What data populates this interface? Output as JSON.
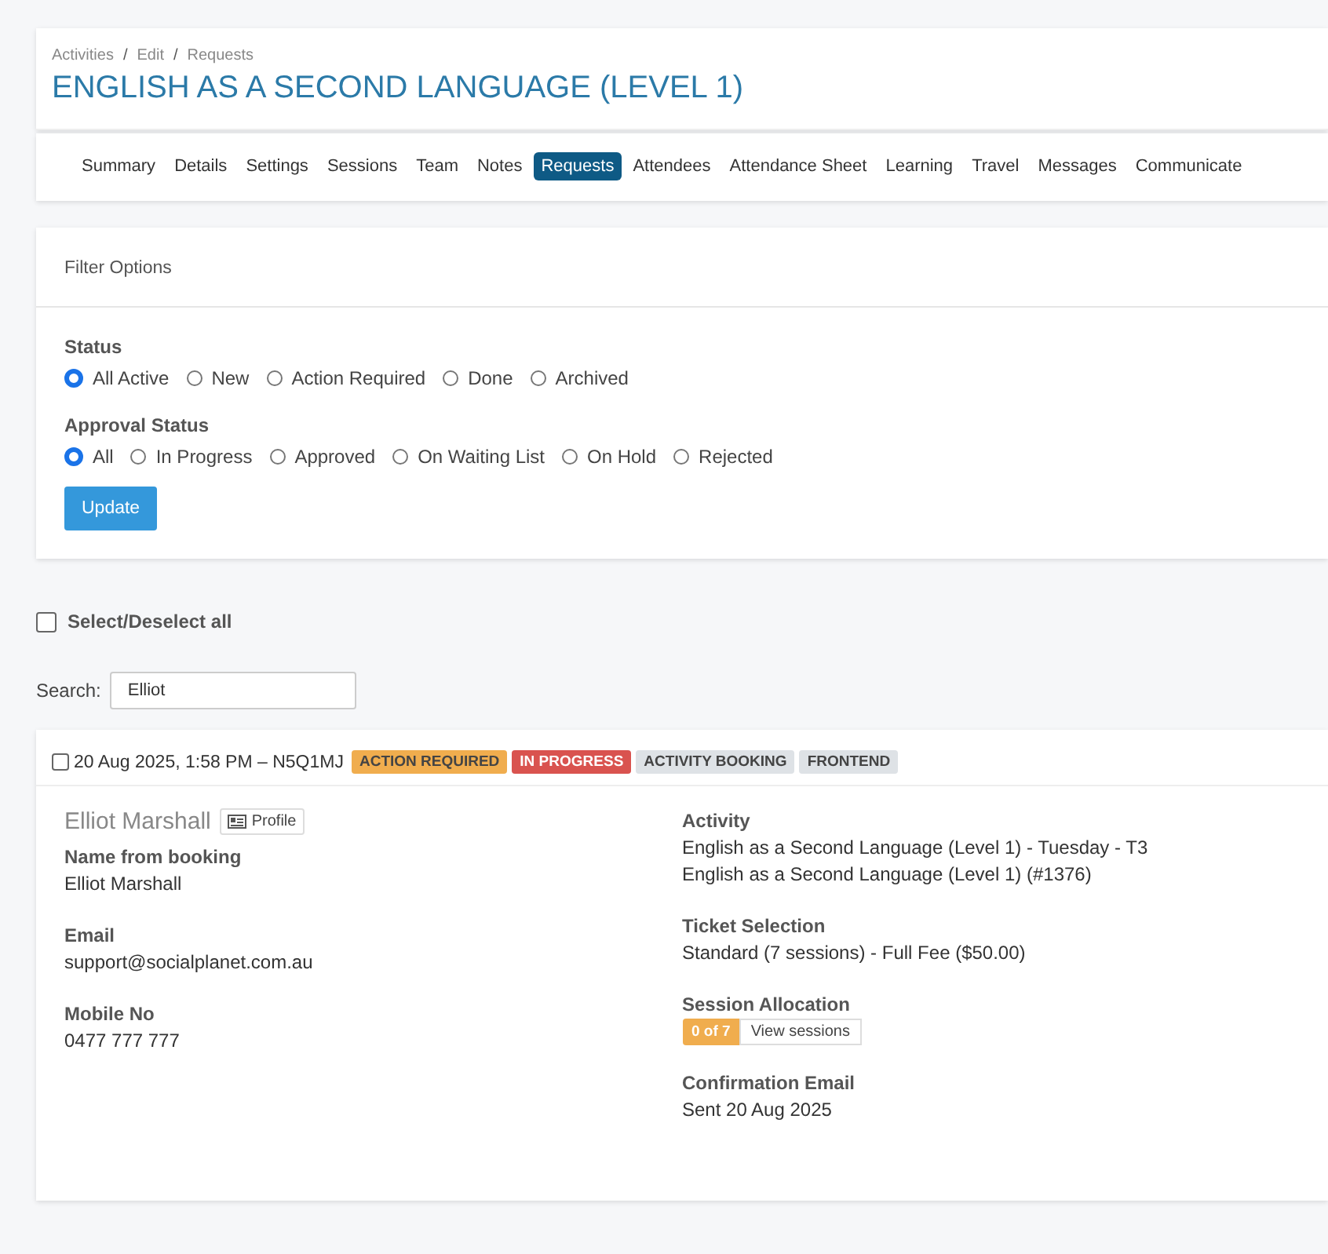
{
  "breadcrumbs": [
    "Activities",
    "Edit",
    "Requests"
  ],
  "breadcrumb_separator": "/",
  "title": "ENGLISH AS A SECOND LANGUAGE (LEVEL 1)",
  "tabs": [
    {
      "label": "Summary",
      "selected": false
    },
    {
      "label": "Details",
      "selected": false
    },
    {
      "label": "Settings",
      "selected": false
    },
    {
      "label": "Sessions",
      "selected": false
    },
    {
      "label": "Team",
      "selected": false
    },
    {
      "label": "Notes",
      "selected": false
    },
    {
      "label": "Requests",
      "selected": true
    },
    {
      "label": "Attendees",
      "selected": false
    },
    {
      "label": "Attendance Sheet",
      "selected": false
    },
    {
      "label": "Learning",
      "selected": false
    },
    {
      "label": "Travel",
      "selected": false
    },
    {
      "label": "Messages",
      "selected": false
    },
    {
      "label": "Communicate",
      "selected": false
    }
  ],
  "filter": {
    "title": "Filter Options",
    "groups": [
      {
        "label": "Status",
        "options": [
          {
            "label": "All Active",
            "selected": true
          },
          {
            "label": "New",
            "selected": false
          },
          {
            "label": "Action Required",
            "selected": false
          },
          {
            "label": "Done",
            "selected": false
          },
          {
            "label": "Archived",
            "selected": false
          }
        ]
      },
      {
        "label": "Approval Status",
        "options": [
          {
            "label": "All",
            "selected": true
          },
          {
            "label": "In Progress",
            "selected": false
          },
          {
            "label": "Approved",
            "selected": false
          },
          {
            "label": "On Waiting List",
            "selected": false
          },
          {
            "label": "On Hold",
            "selected": false
          },
          {
            "label": "Rejected",
            "selected": false
          }
        ]
      }
    ],
    "button": "Update"
  },
  "select_all": {
    "label": "Select/Deselect all",
    "checked": false
  },
  "search": {
    "label": "Search:",
    "value": "Elliot"
  },
  "booking": {
    "checked": false,
    "heading": "20 Aug 2025, 1:58 PM – N5Q1MJ",
    "badges": [
      {
        "label": "ACTION REQUIRED",
        "color": "#f0ad4e"
      },
      {
        "label": "IN PROGRESS",
        "color": "#d9534f"
      },
      {
        "label": "ACTIVITY BOOKING",
        "color": "#dee2e6"
      },
      {
        "label": "FRONTEND",
        "color": "#dee2e6"
      }
    ],
    "name": "Elliot Marshall",
    "profile_button": "Profile",
    "left": [
      {
        "label": "Name from booking",
        "lines": [
          "Elliot Marshall"
        ]
      },
      {
        "label": "Email",
        "lines": [
          "support@socialplanet.com.au"
        ]
      },
      {
        "label": "Mobile No",
        "lines": [
          "0477 777 777"
        ]
      }
    ],
    "right": [
      {
        "kind": "text",
        "label": "Activity",
        "lines": [
          "English as a Second Language (Level 1) - Tuesday - T3",
          "English as a Second Language (Level 1) (#1376)"
        ]
      },
      {
        "kind": "text",
        "label": "Ticket Selection",
        "lines": [
          "Standard (7 sessions) - Full Fee ($50.00)"
        ]
      },
      {
        "kind": "sessions",
        "label": "Session Allocation",
        "count": "0 of 7",
        "button": "View sessions"
      },
      {
        "kind": "text",
        "label": "Confirmation Email",
        "lines": [
          "Sent 20 Aug 2025"
        ]
      }
    ]
  }
}
